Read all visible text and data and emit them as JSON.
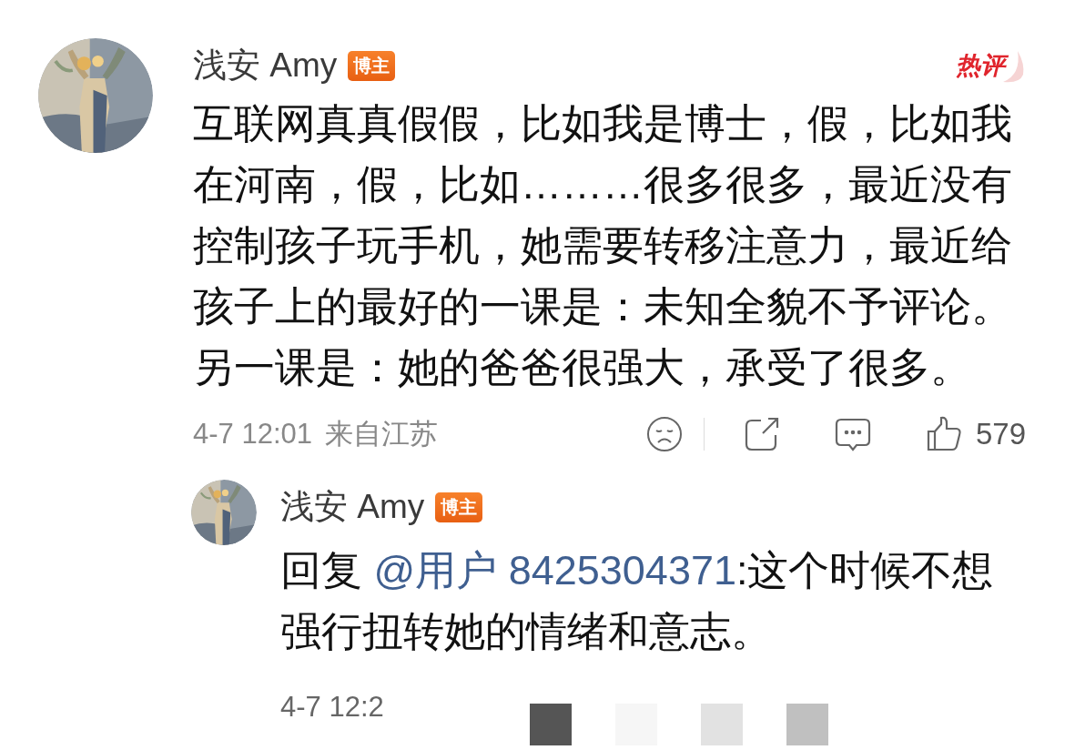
{
  "comment": {
    "author": "浅安 Amy",
    "badge": "博主",
    "tag": "热评",
    "text": "互联网真真假假，比如我是博士，假，比如我在河南，假，比如………很多很多，最近没有控制孩子玩手机，她需要转移注意力，最近给孩子上的最好的一课是：未知全貌不予评论。另一课是：她的爸爸很强大，承受了很多。",
    "time": "4-7 12:01",
    "location": "来自江苏",
    "likes": "579"
  },
  "reply": {
    "author": "浅安 Amy",
    "badge": "博主",
    "prefix": "回复",
    "mention": "@用户 8425304371",
    "text": ":这个时候不想强行扭转她的情绪和意志。",
    "time": "4-7 12:2"
  }
}
